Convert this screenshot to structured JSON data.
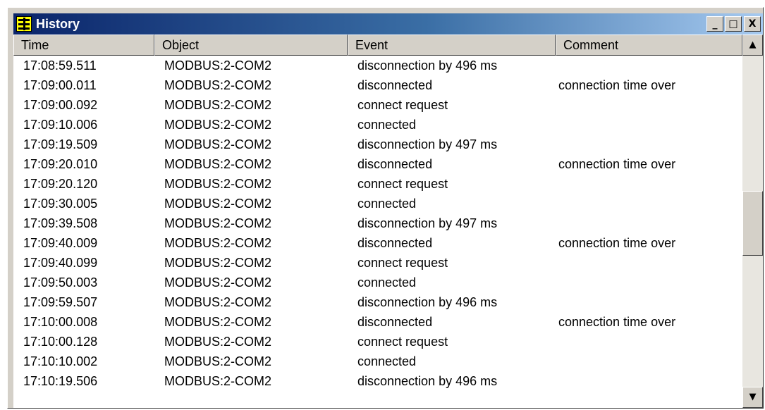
{
  "window": {
    "title": "History",
    "icon": "yellow-app-icon"
  },
  "controls": {
    "minimize": "_",
    "maximize": "□",
    "close": "X"
  },
  "columns": [
    "Time",
    "Object",
    "Event",
    "Comment"
  ],
  "rows": [
    {
      "time": "17:08:59.511",
      "object": "MODBUS:2-COM2",
      "event": "disconnection by 496 ms",
      "comment": ""
    },
    {
      "time": "17:09:00.011",
      "object": "MODBUS:2-COM2",
      "event": "disconnected",
      "comment": "connection time over"
    },
    {
      "time": "17:09:00.092",
      "object": "MODBUS:2-COM2",
      "event": "connect request",
      "comment": ""
    },
    {
      "time": "17:09:10.006",
      "object": "MODBUS:2-COM2",
      "event": "connected",
      "comment": ""
    },
    {
      "time": "17:09:19.509",
      "object": "MODBUS:2-COM2",
      "event": "disconnection by 497 ms",
      "comment": ""
    },
    {
      "time": "17:09:20.010",
      "object": "MODBUS:2-COM2",
      "event": "disconnected",
      "comment": "connection time over"
    },
    {
      "time": "17:09:20.120",
      "object": "MODBUS:2-COM2",
      "event": "connect request",
      "comment": ""
    },
    {
      "time": "17:09:30.005",
      "object": "MODBUS:2-COM2",
      "event": "connected",
      "comment": ""
    },
    {
      "time": "17:09:39.508",
      "object": "MODBUS:2-COM2",
      "event": "disconnection by 497 ms",
      "comment": ""
    },
    {
      "time": "17:09:40.009",
      "object": "MODBUS:2-COM2",
      "event": "disconnected",
      "comment": "connection time over"
    },
    {
      "time": "17:09:40.099",
      "object": "MODBUS:2-COM2",
      "event": "connect request",
      "comment": ""
    },
    {
      "time": "17:09:50.003",
      "object": "MODBUS:2-COM2",
      "event": "connected",
      "comment": ""
    },
    {
      "time": "17:09:59.507",
      "object": "MODBUS:2-COM2",
      "event": "disconnection by 496 ms",
      "comment": ""
    },
    {
      "time": "17:10:00.008",
      "object": "MODBUS:2-COM2",
      "event": "disconnected",
      "comment": "connection time over"
    },
    {
      "time": "17:10:00.128",
      "object": "MODBUS:2-COM2",
      "event": "connect request",
      "comment": ""
    },
    {
      "time": "17:10:10.002",
      "object": "MODBUS:2-COM2",
      "event": "connected",
      "comment": ""
    },
    {
      "time": "17:10:19.506",
      "object": "MODBUS:2-COM2",
      "event": "disconnection by 496 ms",
      "comment": ""
    }
  ],
  "scrollbar": {
    "up": "▲",
    "down": "▼"
  }
}
